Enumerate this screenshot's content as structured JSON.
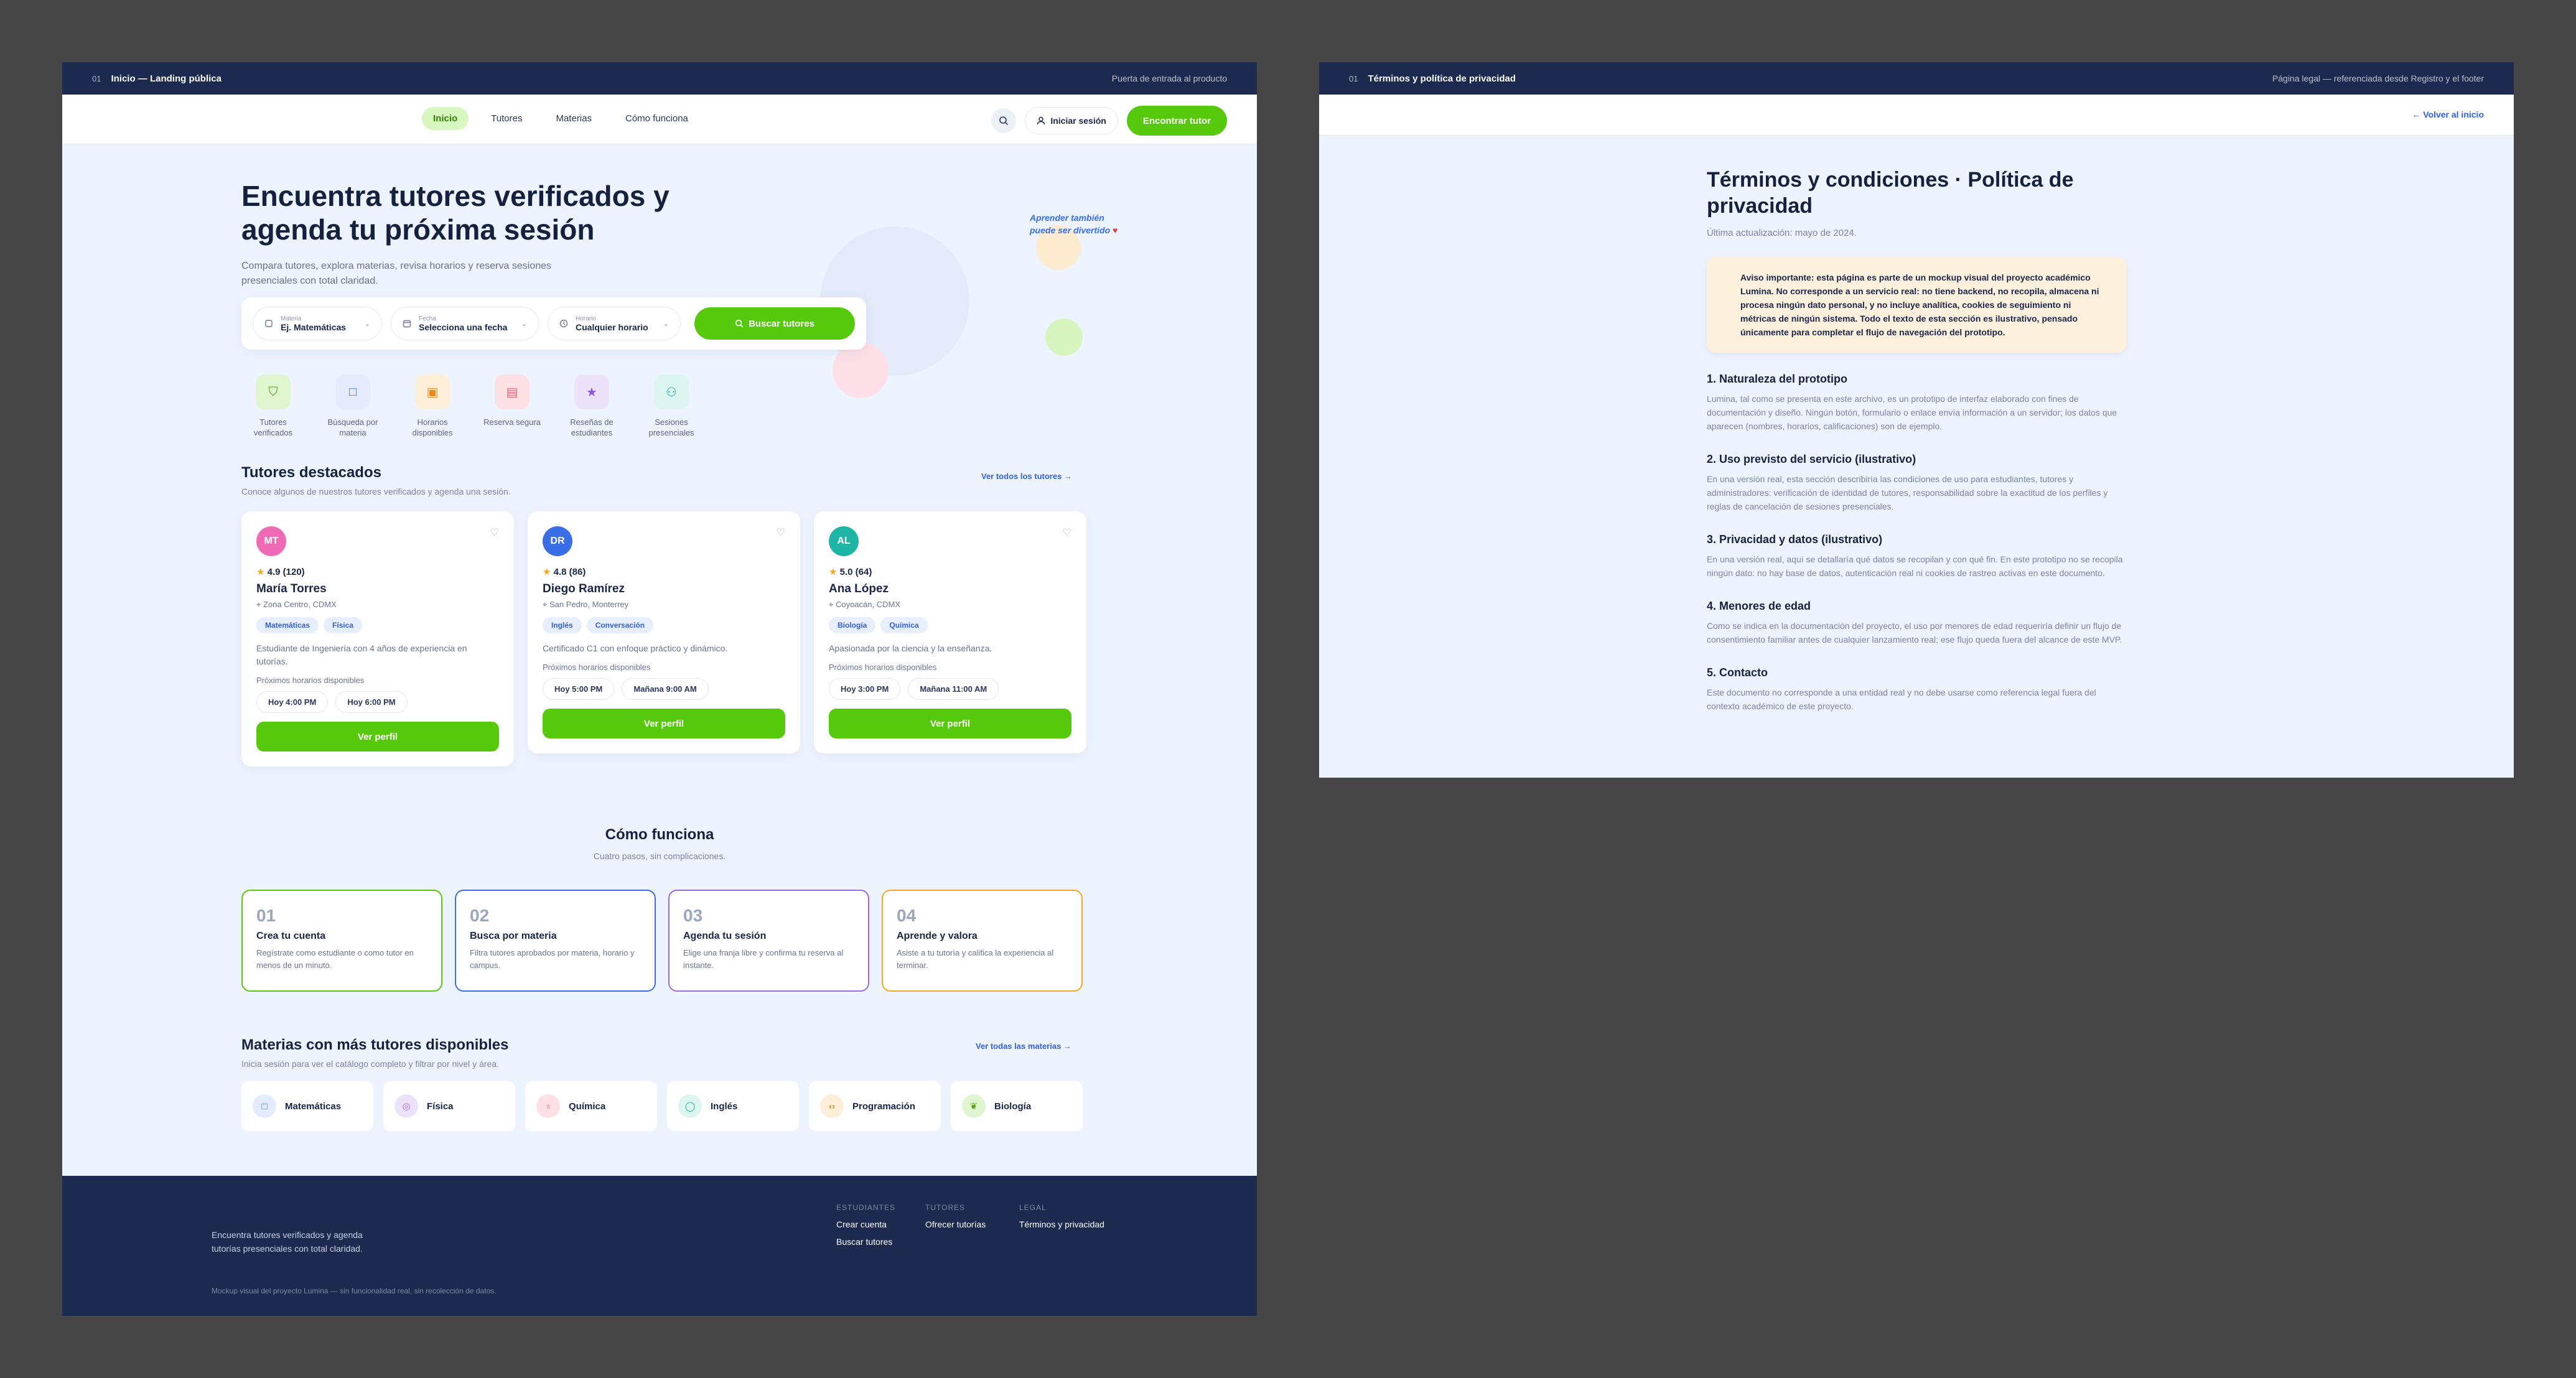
{
  "landing": {
    "bar": {
      "num": "01",
      "title": "Inicio — Landing pública",
      "note": "Puerta de entrada al producto"
    },
    "nav": {
      "links": [
        "Inicio",
        "Tutores",
        "Materias",
        "Cómo funciona"
      ],
      "login": "Iniciar sesión",
      "cta": "Encontrar tutor"
    },
    "hero": {
      "title": "Encuentra tutores verificados y agenda tu próxima sesión",
      "subtitle": "Compara tutores, explora materias, revisa horarios y reserva sesiones presenciales con total claridad.",
      "note_line1": "Aprender también",
      "note_line2": "puede ser divertido",
      "note_heart": "♥"
    },
    "search": {
      "fields": [
        {
          "label": "Materia",
          "value": "Ej. Matemáticas",
          "icon": "book-icon"
        },
        {
          "label": "Fecha",
          "value": "Selecciona una fecha",
          "icon": "calendar-icon"
        },
        {
          "label": "Horario",
          "value": "Cualquier horario",
          "icon": "clock-icon"
        }
      ],
      "button": "Buscar tutores"
    },
    "features": [
      {
        "label": "Tutores verificados",
        "color": "#dff5cf",
        "icon": "shield-icon"
      },
      {
        "label": "Búsqueda por materia",
        "color": "#e3ebfd",
        "icon": "square-icon"
      },
      {
        "label": "Horarios disponibles",
        "color": "#fdeed8",
        "icon": "calendar-icon"
      },
      {
        "label": "Reserva segura",
        "color": "#fde0e4",
        "icon": "calendar-check-icon"
      },
      {
        "label": "Reseñas de estudiantes",
        "color": "#ece3fb",
        "icon": "star-icon"
      },
      {
        "label": "Sesiones presenciales",
        "color": "#dcf5ee",
        "icon": "people-icon"
      }
    ],
    "featured": {
      "title": "Tutores destacados",
      "subtitle": "Conoce algunos de nuestros tutores verificados y agenda una sesión.",
      "link": "Ver todos los tutores →",
      "tutors": [
        {
          "initials": "MT",
          "color": "#f06bb5",
          "rating": "4.9 (120)",
          "name": "María Torres",
          "location": "Zona Centro, CDMX",
          "tags": [
            "Matemáticas",
            "Física"
          ],
          "desc": "Estudiante de Ingeniería con 4 años de experiencia en tutorías.",
          "slots_label": "Próximos horarios disponibles",
          "slots": [
            "Hoy 4:00 PM",
            "Hoy 6:00 PM"
          ],
          "button": "Ver perfil"
        },
        {
          "initials": "DR",
          "color": "#3a6ee6",
          "rating": "4.8 (86)",
          "name": "Diego Ramírez",
          "location": "San Pedro, Monterrey",
          "tags": [
            "Inglés",
            "Conversación"
          ],
          "desc": "Certificado C1 con enfoque práctico y dinámico.",
          "slots_label": "Próximos horarios disponibles",
          "slots": [
            "Hoy 5:00 PM",
            "Mañana 9:00 AM"
          ],
          "button": "Ver perfil"
        },
        {
          "initials": "AL",
          "color": "#1fb5a5",
          "rating": "5.0 (64)",
          "name": "Ana López",
          "location": "Coyoacán, CDMX",
          "tags": [
            "Biología",
            "Química"
          ],
          "desc": "Apasionada por la ciencia y la enseñanza.",
          "slots_label": "Próximos horarios disponibles",
          "slots": [
            "Hoy 3:00 PM",
            "Mañana 11:00 AM"
          ],
          "button": "Ver perfil"
        }
      ]
    },
    "how": {
      "title": "Cómo funciona",
      "subtitle": "Cuatro pasos, sin complicaciones.",
      "steps": [
        {
          "num": "01",
          "title": "Crea tu cuenta",
          "desc": "Regístrate como estudiante o como tutor en menos de un minuto.",
          "color": "#56c90d"
        },
        {
          "num": "02",
          "title": "Busca por materia",
          "desc": "Filtra tutores aprobados por materia, horario y campus.",
          "color": "#3a6ee6"
        },
        {
          "num": "03",
          "title": "Agenda tu sesión",
          "desc": "Elige una franja libre y confirma tu reserva al instante.",
          "color": "#9a6ae6"
        },
        {
          "num": "04",
          "title": "Aprende y valora",
          "desc": "Asiste a tu tutoría y califica la experiencia al terminar.",
          "color": "#f5a623"
        }
      ]
    },
    "subjects": {
      "title": "Materias con más tutores disponibles",
      "subtitle": "Inicia sesión para ver el catálogo completo y filtrar por nivel y área.",
      "link": "Ver todas las materias →",
      "items": [
        {
          "name": "Matemáticas",
          "color": "#e3ebfd",
          "fg": "#3a6ee6",
          "glyph": "□"
        },
        {
          "name": "Física",
          "color": "#ece3fb",
          "fg": "#9a6ae6",
          "glyph": "◎"
        },
        {
          "name": "Química",
          "color": "#fde0e4",
          "fg": "#e6617a",
          "glyph": "♁"
        },
        {
          "name": "Inglés",
          "color": "#dcf5ee",
          "fg": "#1fb5a5",
          "glyph": "◯"
        },
        {
          "name": "Programación",
          "color": "#fdeed8",
          "fg": "#e68a1f",
          "glyph": "‹›"
        },
        {
          "name": "Biología",
          "color": "#dff5cf",
          "fg": "#56a00d",
          "glyph": "❦"
        }
      ]
    },
    "footer": {
      "tagline": "Encuentra tutores verificados y agenda tutorías presenciales con total claridad.",
      "columns": [
        {
          "heading": "ESTUDIANTES",
          "items": [
            "Crear cuenta",
            "Buscar tutores"
          ]
        },
        {
          "heading": "TUTORES",
          "items": [
            "Ofrecer tutorías"
          ]
        },
        {
          "heading": "LEGAL",
          "items": [
            "Términos y privacidad"
          ]
        }
      ],
      "note": "Mockup visual del proyecto Lumina — sin funcionalidad real, sin recolección de datos."
    }
  },
  "legal": {
    "bar": {
      "num": "01",
      "title": "Términos y política de privacidad",
      "note": "Página legal — referenciada desde Registro y el footer"
    },
    "back": "← Volver al inicio",
    "title": "Términos y condiciones · Política de privacidad",
    "updated": "Última actualización: mayo de 2024.",
    "notice_prefix": "Aviso importante: esta página es parte de un ",
    "notice_bold": "mockup visual",
    "notice_rest": " del proyecto académico Lumina. No corresponde a un servicio real: no tiene backend, no recopila, almacena ni procesa ningún dato personal, y no incluye analítica, cookies de seguimiento ni métricas de ningún sistema. Todo el texto de esta sección es ilustrativo, pensado únicamente para completar el flujo de navegación del prototipo.",
    "sections": [
      {
        "title": "1. Naturaleza del prototipo",
        "body": "Lumina, tal como se presenta en este archivo, es un prototipo de interfaz elaborado con fines de documentación y diseño. Ningún botón, formulario o enlace envía información a un servidor; los datos que aparecen (nombres, horarios, calificaciones) son de ejemplo."
      },
      {
        "title": "2. Uso previsto del servicio (ilustrativo)",
        "body": "En una versión real, esta sección describiría las condiciones de uso para estudiantes, tutores y administradores: verificación de identidad de tutores, responsabilidad sobre la exactitud de los perfiles y reglas de cancelación de sesiones presenciales."
      },
      {
        "title": "3. Privacidad y datos (ilustrativo)",
        "body": "En una versión real, aquí se detallaría qué datos se recopilan y con qué fin. En este prototipo no se recopila ningún dato: no hay base de datos, autenticación real ni cookies de rastreo activas en este documento."
      },
      {
        "title": "4. Menores de edad",
        "body": "Como se indica en la documentación del proyecto, el uso por menores de edad requeriría definir un flujo de consentimiento familiar antes de cualquier lanzamiento real; ese flujo queda fuera del alcance de este MVP."
      },
      {
        "title": "5. Contacto",
        "body": "Este documento no corresponde a una entidad real y no debe usarse como referencia legal fuera del contexto académico de este proyecto."
      }
    ]
  }
}
